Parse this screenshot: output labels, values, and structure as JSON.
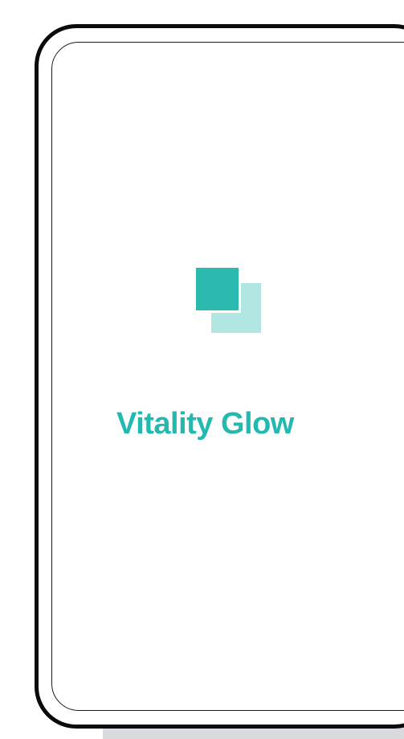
{
  "app": {
    "title": "Vitality Glow"
  },
  "logo": {
    "icon": "overlapping-squares-icon"
  },
  "colors": {
    "accent": "#2cb9b0",
    "accent_light": "#b2e6e2",
    "title": "#23b8b0",
    "frame": "#0b0b0b",
    "background": "#ffffff",
    "shadow": "#d9dadd"
  }
}
